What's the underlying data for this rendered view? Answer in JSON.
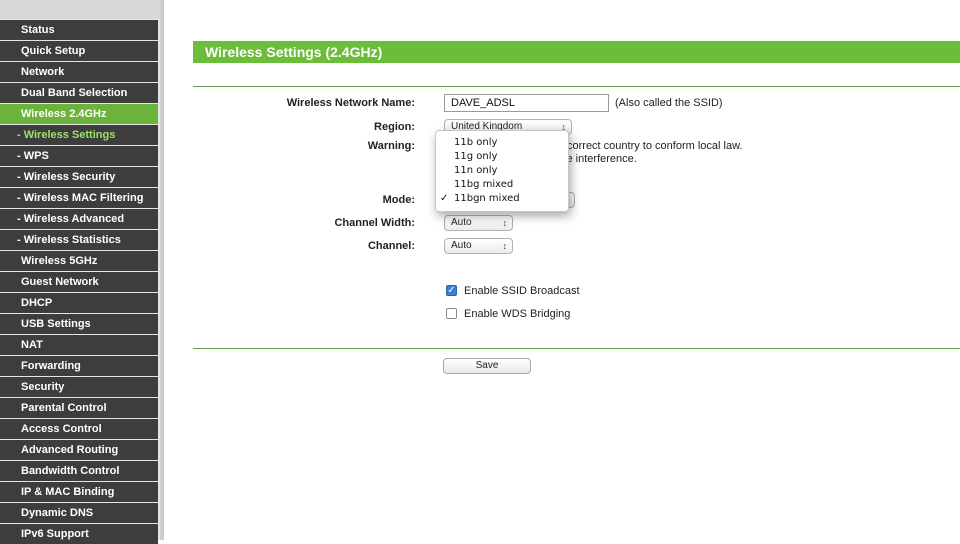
{
  "sidebar": {
    "items": [
      {
        "label": "Status"
      },
      {
        "label": "Quick Setup"
      },
      {
        "label": "Network"
      },
      {
        "label": "Dual Band Selection"
      },
      {
        "label": "Wireless 2.4GHz"
      },
      {
        "label": "- Wireless Settings"
      },
      {
        "label": "- WPS"
      },
      {
        "label": "- Wireless Security"
      },
      {
        "label": "- Wireless MAC Filtering"
      },
      {
        "label": "- Wireless Advanced"
      },
      {
        "label": "- Wireless Statistics"
      },
      {
        "label": "Wireless 5GHz"
      },
      {
        "label": "Guest Network"
      },
      {
        "label": "DHCP"
      },
      {
        "label": "USB Settings"
      },
      {
        "label": "NAT"
      },
      {
        "label": "Forwarding"
      },
      {
        "label": "Security"
      },
      {
        "label": "Parental Control"
      },
      {
        "label": "Access Control"
      },
      {
        "label": "Advanced Routing"
      },
      {
        "label": "Bandwidth Control"
      },
      {
        "label": "IP & MAC Binding"
      },
      {
        "label": "Dynamic DNS"
      },
      {
        "label": "IPv6 Support"
      }
    ]
  },
  "page": {
    "title": "Wireless Settings (2.4GHz)"
  },
  "form": {
    "ssid_label": "Wireless Network Name:",
    "ssid_value": "DAVE_ADSL",
    "ssid_note": "(Also called the SSID)",
    "region_label": "Region:",
    "region_value": "United Kingdom",
    "warning_label": "Warning:",
    "warning_line1": "correct country to conform local law.",
    "warning_line2": "se interference.",
    "mode_label": "Mode:",
    "channel_width_label": "Channel Width:",
    "channel_width_value": "Auto",
    "channel_label": "Channel:",
    "channel_value": "Auto",
    "ssid_broadcast_label": "Enable SSID Broadcast",
    "ssid_broadcast_checked": true,
    "wds_label": "Enable WDS Bridging",
    "wds_checked": false,
    "save_label": "Save"
  },
  "mode_dropdown": {
    "options": [
      "11b only",
      "11g only",
      "11n only",
      "11bg mixed",
      "11bgn mixed"
    ],
    "selected": "11bgn mixed",
    "check_mark": "✓"
  },
  "colors": {
    "accent_green": "#6bbd3a",
    "sidebar_bg": "#3d3d3d"
  }
}
